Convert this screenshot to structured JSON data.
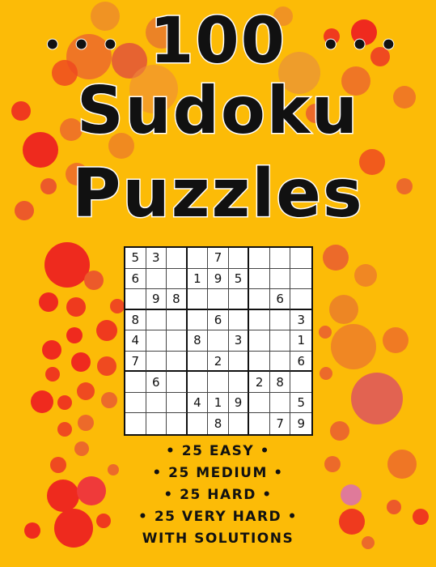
{
  "cover": {
    "title_line1": "100",
    "title_line2": "Sudoku",
    "title_line3": "Puzzles",
    "dots_left": "•••",
    "dots_right": "•••",
    "levels": [
      "• 25 EASY •",
      "• 25 MEDIUM •",
      "• 25 HARD •",
      "• 25 VERY HARD •",
      "WITH SOLUTIONS"
    ]
  },
  "sudoku": [
    [
      "5",
      "3",
      "",
      "",
      "7",
      "",
      "",
      "",
      ""
    ],
    [
      "6",
      "",
      "",
      "1",
      "9",
      "5",
      "",
      "",
      ""
    ],
    [
      "",
      "9",
      "8",
      "",
      "",
      "",
      "",
      "6",
      ""
    ],
    [
      "8",
      "",
      "",
      "",
      "6",
      "",
      "",
      "",
      "3"
    ],
    [
      "4",
      "",
      "",
      "8",
      "",
      "3",
      "",
      "",
      "1"
    ],
    [
      "7",
      "",
      "",
      "",
      "2",
      "",
      "",
      "",
      "6"
    ],
    [
      "",
      "6",
      "",
      "",
      "",
      "",
      "2",
      "8",
      ""
    ],
    [
      "",
      "",
      "",
      "4",
      "1",
      "9",
      "",
      "",
      "5"
    ],
    [
      "",
      "",
      "",
      "",
      "8",
      "",
      "",
      "7",
      "9"
    ]
  ],
  "colors": {
    "background": "#fcbb07",
    "bubble_red": "#ee2a1e",
    "bubble_orange": "#ec6a2a",
    "bubble_pink": "#df6a80",
    "text": "#111111"
  }
}
